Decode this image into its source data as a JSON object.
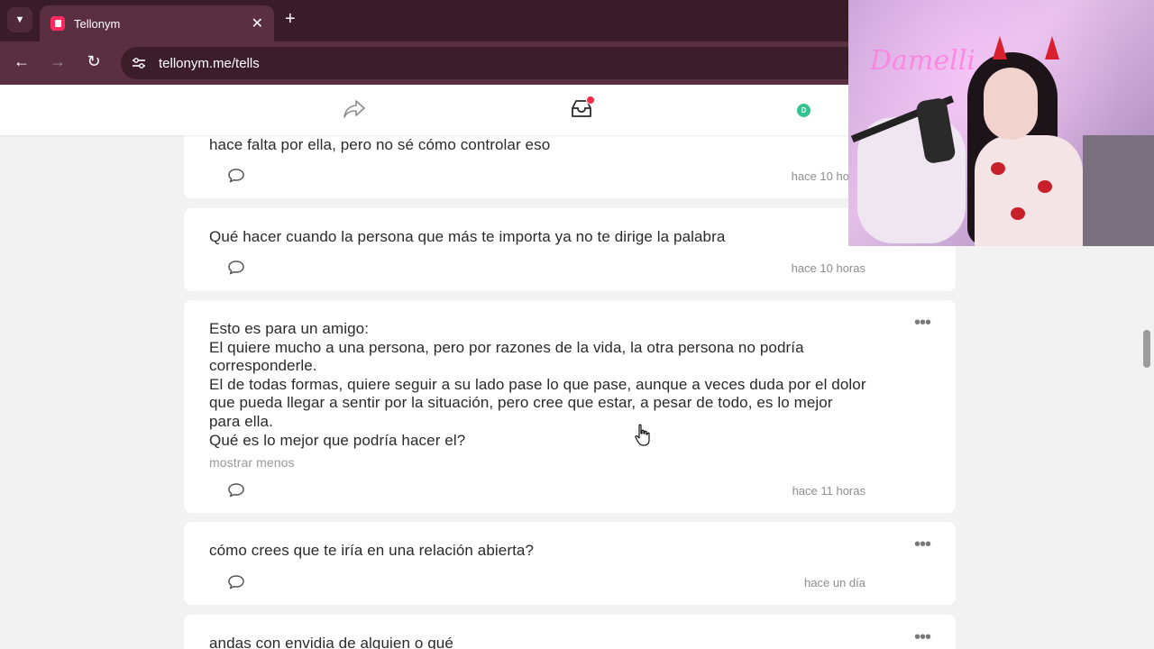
{
  "browser": {
    "tab_title": "Tellonym",
    "tab_close": "✕",
    "new_tab": "+",
    "url": "tellonym.me/tells"
  },
  "header": {
    "avatar_letter": "D",
    "inbox_badge": true
  },
  "feed": [
    {
      "text": "hace falta por ella, pero no sé cómo controlar eso",
      "time": "hace 10 horas"
    },
    {
      "text": "Qué hacer cuando la persona que más te importa ya no te dirige la palabra",
      "time": "hace 10 horas"
    },
    {
      "lines": [
        "Esto es para un amigo:",
        "El quiere mucho a una persona, pero por razones de la vida, la otra persona no podría corresponderle.",
        "El de todas formas, quiere seguir a su lado pase lo que pase, aunque a veces duda por el dolor que pueda llegar a sentir por la situación, pero cree que estar, a pesar de todo, es lo mejor para ella.",
        "Qué es lo mejor que podría hacer el?"
      ],
      "show_less": "mostrar menos",
      "time": "hace 11 horas"
    },
    {
      "text": "cómo crees que te iría en una relación abierta?",
      "time": "hace un día"
    },
    {
      "text": "andas con envidia de alguien o qué"
    }
  ],
  "more_label": "•••",
  "webcam": {
    "neon_sign": "Damelli"
  },
  "colors": {
    "brand": "#ff2a5f",
    "tabbar": "#3a1b28",
    "toolbar": "#5a2f41",
    "badge": "#ff2a4a",
    "avatar": "#34c38f"
  }
}
